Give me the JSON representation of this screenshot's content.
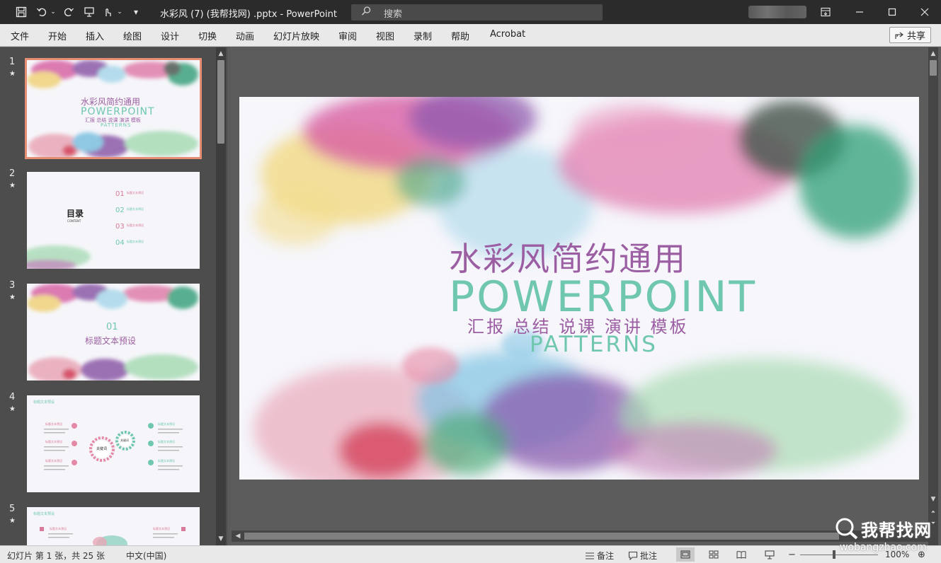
{
  "titlebar": {
    "doc_title": "水彩风 (7) (我帮找网) .pptx  -  PowerPoint",
    "search_placeholder": "搜索"
  },
  "ribbon": {
    "tabs": [
      "文件",
      "开始",
      "插入",
      "绘图",
      "设计",
      "切换",
      "动画",
      "幻灯片放映",
      "审阅",
      "视图",
      "录制",
      "帮助",
      "Acrobat"
    ],
    "share_label": "共享"
  },
  "thumbnails": [
    {
      "num": "1",
      "star": "★",
      "selected": true,
      "title_cn": "水彩风简约通用",
      "title_en": "POWERPOINT",
      "sub_cn": "汇报 总结 说课 演讲 模板",
      "sub_en": "PATTERNS"
    },
    {
      "num": "2",
      "star": "★",
      "title_cn": "目录",
      "title_en": "CONTENT",
      "items": [
        "01",
        "02",
        "03",
        "04"
      ],
      "item_title": "标题文本预设"
    },
    {
      "num": "3",
      "star": "★",
      "big_num": "01",
      "title_cn": "标题文本预设"
    },
    {
      "num": "4",
      "star": "★",
      "header": "标题文本预设",
      "center_a": "关键词",
      "center_b": "关键词",
      "item_title": "标题文本预设"
    },
    {
      "num": "5",
      "star": "★",
      "header": "标题文本预设",
      "item_title": "标题文本预设"
    }
  ],
  "slide": {
    "title_cn": "水彩风简约通用",
    "title_en": "POWERPOINT",
    "subtitle_cn": "汇报  总结  说课  演讲  模板",
    "subtitle_en": "PATTERNS"
  },
  "statusbar": {
    "slide_info": "幻灯片 第 1 张，共 25 张",
    "language": "中文(中国)",
    "notes_label": "备注",
    "comments_label": "批注",
    "zoom": "100%"
  },
  "watermark": {
    "brand": "我帮找网",
    "url": "wobangzhao.com"
  },
  "colors": {
    "title_purple": "#9b5ea2",
    "title_teal": "#6fc7ad",
    "selection": "#e58e74"
  }
}
